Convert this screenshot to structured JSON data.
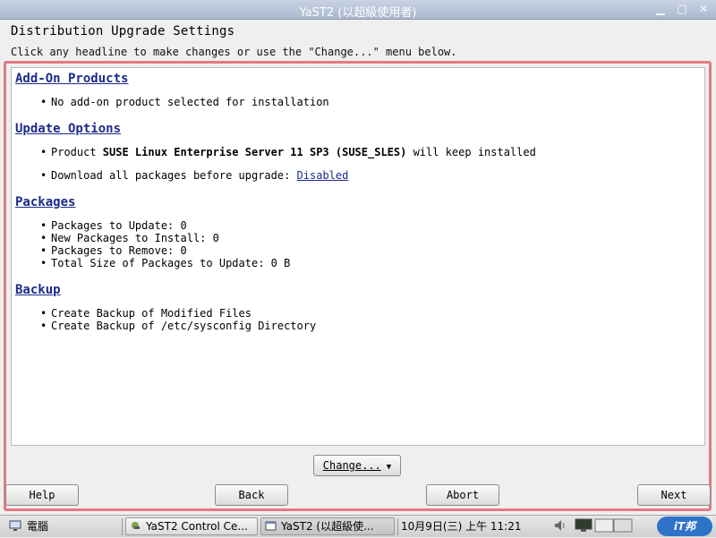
{
  "window": {
    "title": "YaST2 (以超級使用者)"
  },
  "heading": "Distribution Upgrade Settings",
  "subheading": "Click any headline to make changes or use the \"Change...\" menu below.",
  "sections": [
    {
      "title": "Add-On Products",
      "items": [
        {
          "text": "No add-on product selected for installation"
        }
      ]
    },
    {
      "title": "Update Options",
      "items": [
        {
          "pre": "Product ",
          "bold": "SUSE Linux Enterprise Server 11 SP3 (SUSE_SLES)",
          "post": " will keep installed"
        },
        {
          "pre": "Download all packages before upgrade: ",
          "link": "Disabled"
        }
      ]
    },
    {
      "title": "Packages",
      "items": [
        {
          "text": "Packages to Update: 0"
        },
        {
          "text": "New Packages to Install: 0"
        },
        {
          "text": "Packages to Remove: 0"
        },
        {
          "text": "Total Size of Packages to Update: 0 B"
        }
      ]
    },
    {
      "title": "Backup",
      "items": [
        {
          "text": "Create Backup of Modified Files"
        },
        {
          "text": "Create Backup of /etc/sysconfig Directory"
        }
      ]
    }
  ],
  "buttons": {
    "change": "Change...",
    "help": "Help",
    "back": "Back",
    "abort": "Abort",
    "next": "Next"
  },
  "taskbar": {
    "computer": "電腦",
    "task1": "YaST2 Control Ce...",
    "task2": "YaST2 (以超級使...",
    "datetime": "10月9日(三) 上午 11:21",
    "logo": "iT邦"
  },
  "colors": {
    "link": "#1c2b8c",
    "highlight_border": "#e27a82",
    "titlebar": "#a9b8cf"
  }
}
